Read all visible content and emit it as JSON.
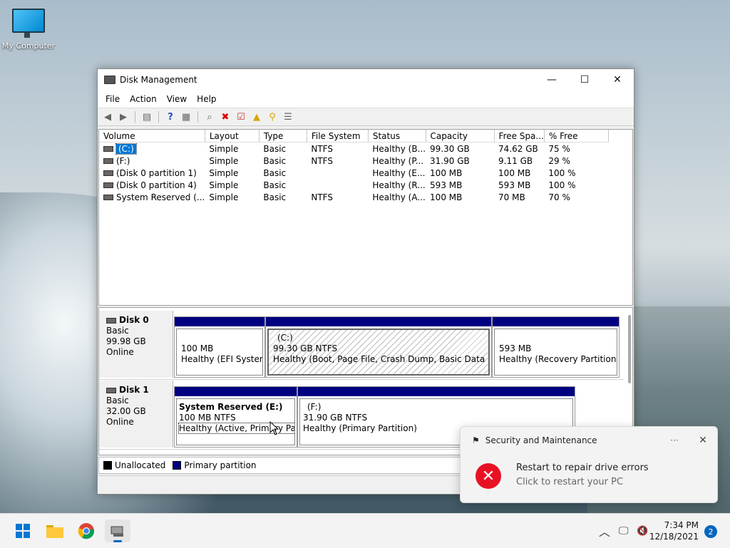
{
  "desktop": {
    "icon_label": "My Computer"
  },
  "window": {
    "title": "Disk Management",
    "menu": [
      "File",
      "Action",
      "View",
      "Help"
    ]
  },
  "volumes": {
    "columns": [
      "Volume",
      "Layout",
      "Type",
      "File System",
      "Status",
      "Capacity",
      "Free Spa...",
      "% Free"
    ],
    "rows": [
      [
        "(C:)",
        "Simple",
        "Basic",
        "NTFS",
        "Healthy (B...",
        "99.30 GB",
        "74.62 GB",
        "75 %"
      ],
      [
        "(F:)",
        "Simple",
        "Basic",
        "NTFS",
        "Healthy (P...",
        "31.90 GB",
        "9.11 GB",
        "29 %"
      ],
      [
        "(Disk 0 partition 1)",
        "Simple",
        "Basic",
        "",
        "Healthy (E...",
        "100 MB",
        "100 MB",
        "100 %"
      ],
      [
        "(Disk 0 partition 4)",
        "Simple",
        "Basic",
        "",
        "Healthy (R...",
        "593 MB",
        "593 MB",
        "100 %"
      ],
      [
        "System Reserved (...",
        "Simple",
        "Basic",
        "NTFS",
        "Healthy (A...",
        "100 MB",
        "70 MB",
        "70 %"
      ]
    ]
  },
  "disks": [
    {
      "name": "Disk 0",
      "type": "Basic",
      "size": "99.98 GB",
      "state": "Online",
      "partitions": [
        {
          "title": "",
          "size": "100 MB",
          "status": "Healthy (EFI System P"
        },
        {
          "title": "(C:)",
          "size": "99.30 GB NTFS",
          "status": "Healthy (Boot, Page File, Crash Dump, Basic Data Partitior"
        },
        {
          "title": "",
          "size": "593 MB",
          "status": "Healthy (Recovery Partition)"
        }
      ]
    },
    {
      "name": "Disk 1",
      "type": "Basic",
      "size": "32.00 GB",
      "state": "Online",
      "partitions": [
        {
          "title": "System Reserved  (E:)",
          "size": "100 MB NTFS",
          "status": "Healthy (Active, Primary Partition)"
        },
        {
          "title": "(F:)",
          "size": "31.90 GB NTFS",
          "status": "Healthy (Primary Partition)"
        }
      ]
    }
  ],
  "legend": {
    "unallocated": "Unallocated",
    "primary": "Primary partition"
  },
  "colors": {
    "primary": "#000080",
    "unallocated": "#000000",
    "accent": "#0078d7",
    "error": "#e81123"
  },
  "toast": {
    "app": "Security and Maintenance",
    "dots": "···",
    "close": "✕",
    "title": "Restart to repair drive errors",
    "subtitle": "Click to restart your PC"
  },
  "taskbar": {
    "time": "7:34 PM",
    "date": "12/18/2021",
    "notification_count": "2"
  }
}
